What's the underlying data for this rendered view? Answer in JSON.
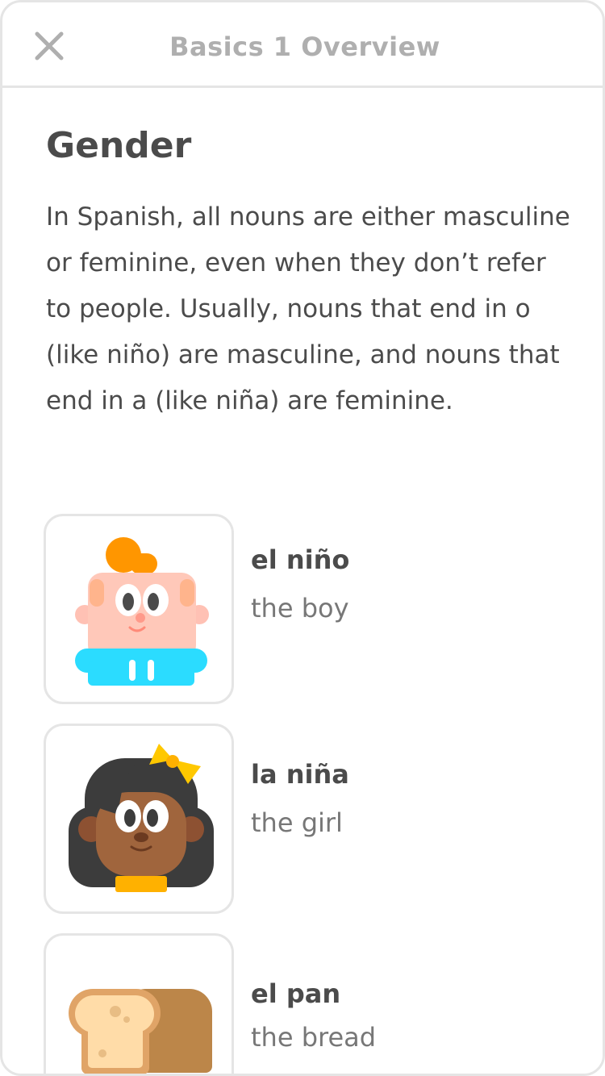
{
  "header": {
    "title": "Basics 1 Overview",
    "close_icon": "close-icon"
  },
  "section": {
    "title": "Gender",
    "body": "In Spanish, all nouns are either masculine or feminine, even when they don’t refer to people. Usually, nouns that end in o (like niño) are masculine, and nouns that end in a (like niña) are feminine."
  },
  "vocab": [
    {
      "word": "el niño",
      "translation": "the boy",
      "image": "boy-illustration"
    },
    {
      "word": "la niña",
      "translation": "the girl",
      "image": "girl-illustration"
    },
    {
      "word": "el pan",
      "translation": "the bread",
      "image": "bread-illustration"
    }
  ],
  "colors": {
    "border": "#e5e5e5",
    "title_gray": "#afafaf",
    "text": "#4b4b4b",
    "secondary_text": "#777777",
    "boy_hair": "#ff9600",
    "boy_shirt": "#2bdcff",
    "girl_bow": "#ffc800",
    "bread_crust": "#bc8649"
  }
}
